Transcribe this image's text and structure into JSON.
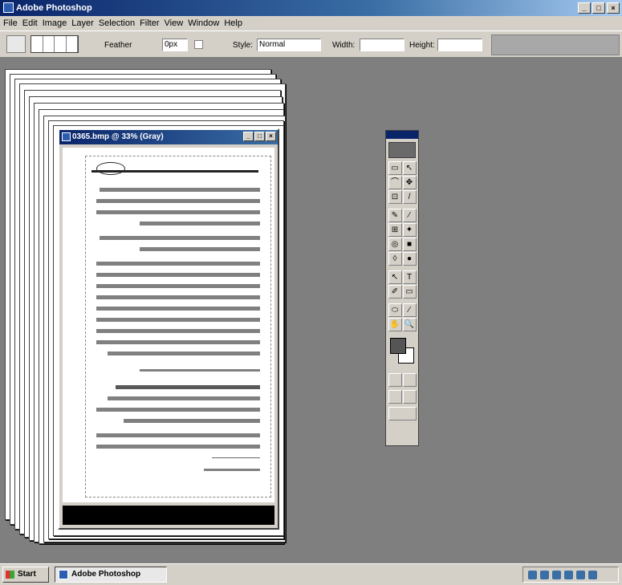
{
  "app": {
    "title": "Adobe Photoshop"
  },
  "menu": [
    "File",
    "Edit",
    "Image",
    "Layer",
    "Selection",
    "Filter",
    "View",
    "Window",
    "Help"
  ],
  "options": {
    "antialiased_label": "Feather",
    "feather_value": "0px",
    "style_label": "Style:",
    "style_value": "Normal",
    "width_label": "Width:",
    "height_label": "Height:"
  },
  "document": {
    "title": "0365.bmp @ 33% (Gray)"
  },
  "toolbox": {
    "tools": [
      [
        "▭",
        "↖"
      ],
      [
        "⌒",
        "✥"
      ],
      [
        "⊡",
        "/"
      ],
      [
        "✎",
        "⁄"
      ],
      [
        "⊞",
        "✦"
      ],
      [
        "◎",
        "■"
      ],
      [
        "◊",
        "●"
      ],
      [
        "↖",
        "T"
      ],
      [
        "✐",
        "▭"
      ],
      [
        "⬭",
        "⁄"
      ],
      [
        "✋",
        "🔍"
      ]
    ]
  },
  "taskbar": {
    "start_label": "Start",
    "task_label": "Adobe Photoshop"
  },
  "colors": {
    "title_bar": "#0a246a",
    "workspace": "#808080",
    "chrome": "#d4d0c8"
  }
}
